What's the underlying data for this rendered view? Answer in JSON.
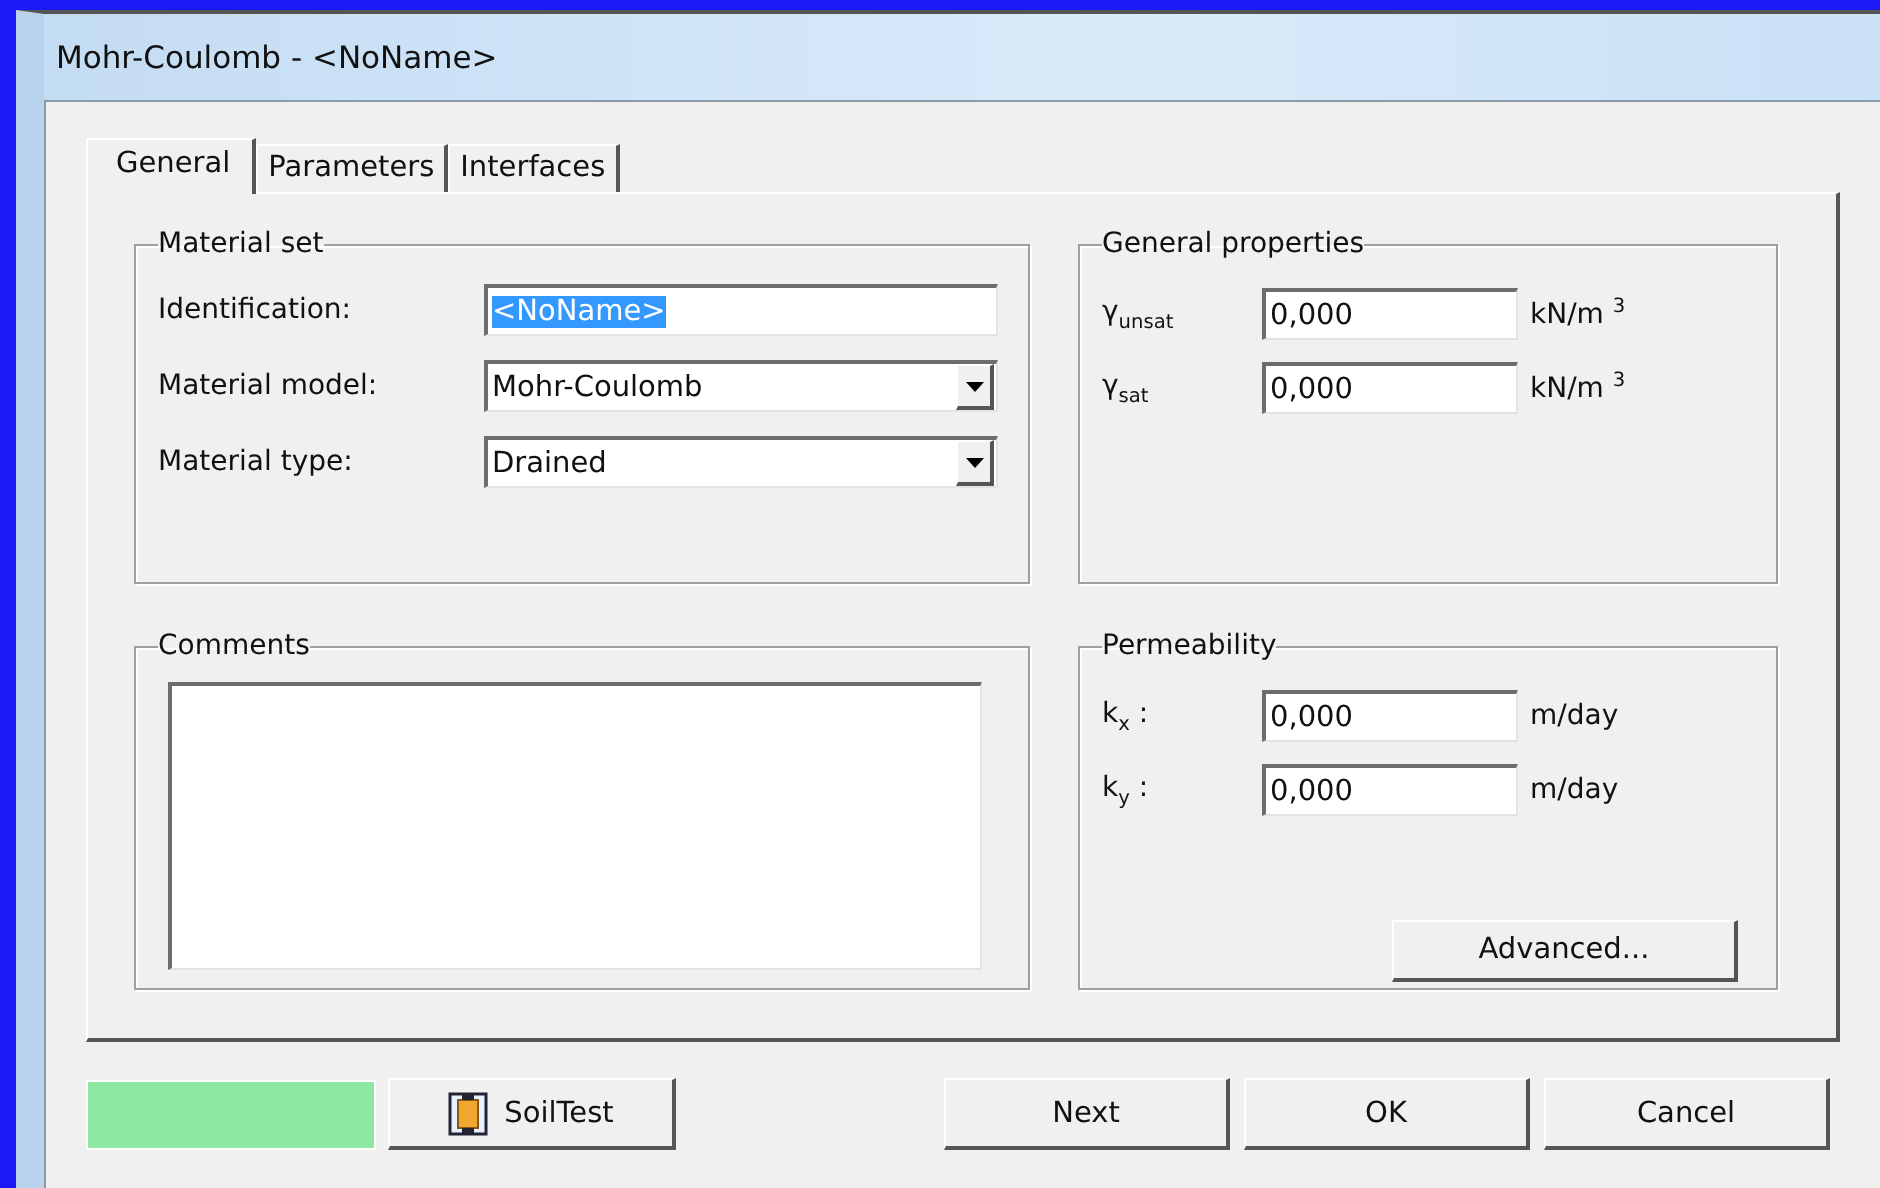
{
  "window": {
    "title": "Mohr-Coulomb - <NoName>"
  },
  "tabs": [
    {
      "label": "General",
      "selected": true
    },
    {
      "label": "Parameters",
      "selected": false
    },
    {
      "label": "Interfaces",
      "selected": false
    }
  ],
  "material_set": {
    "title": "Material set",
    "rows": [
      {
        "kind": "text",
        "label": "Identification:",
        "value": "<NoName>",
        "selected": true
      },
      {
        "kind": "dropdown",
        "label": "Material model:",
        "value": "Mohr-Coulomb"
      },
      {
        "kind": "dropdown",
        "label": "Material type:",
        "value": "Drained"
      }
    ]
  },
  "general_properties": {
    "title": "General properties",
    "rows": [
      {
        "label": "γ$_{unsat}$",
        "value": "0,000",
        "unit": "kN/m $^{3}$"
      },
      {
        "label": "γ$_{sat}$",
        "value": "0,000",
        "unit": "kN/m $^{3}$"
      }
    ]
  },
  "comments": {
    "title": "Comments"
  },
  "permeability": {
    "title": "Permeability",
    "rows": [
      {
        "label": "k$_{x}$ :",
        "value": "0,000",
        "unit": "m/day"
      },
      {
        "label": "k$_{y}$ :",
        "value": "0,000",
        "unit": "m/day"
      }
    ],
    "button": "Advanced..."
  },
  "color_swatch": {
    "color": "#8ee8a2"
  },
  "buttons": [
    {
      "kind": "soiltest",
      "label": "SoilTest"
    },
    {
      "kind": "plain",
      "label": "Next"
    },
    {
      "kind": "plain",
      "label": "OK"
    },
    {
      "kind": "plain",
      "label": "Cancel"
    }
  ]
}
